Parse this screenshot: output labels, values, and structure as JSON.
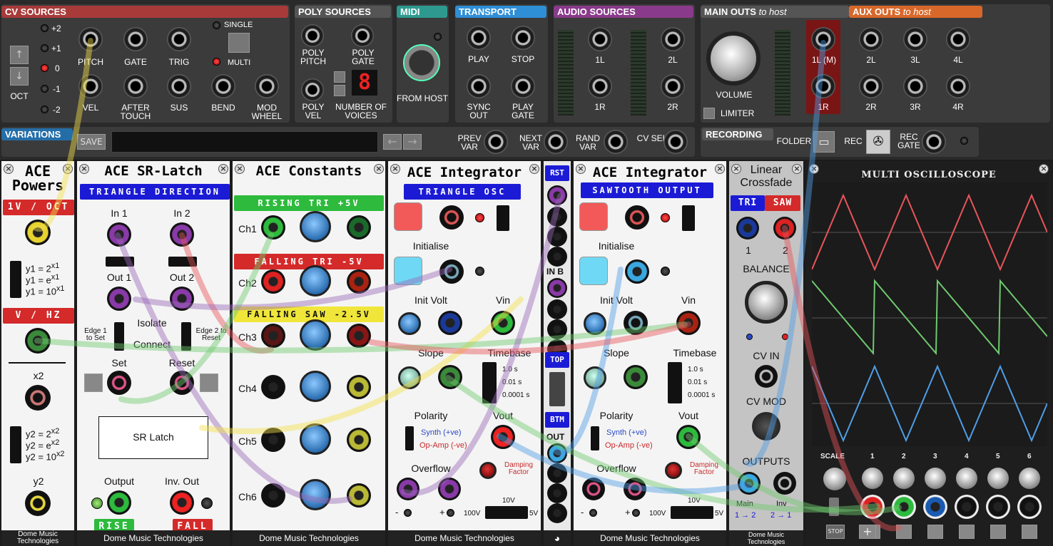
{
  "top": {
    "cv": {
      "title": "CV SOURCES",
      "oct": "OCT",
      "octs": [
        "+2",
        "+1",
        "0",
        "-1",
        "-2"
      ],
      "pitch": "PITCH",
      "gate": "GATE",
      "trig": "TRIG",
      "single": "SINGLE",
      "multi": "MULTI",
      "vel": "VEL",
      "after": "AFTER TOUCH",
      "sus": "SUS",
      "bend": "BEND",
      "mod": "MOD WHEEL"
    },
    "poly": {
      "title": "POLY SOURCES",
      "pitch": "POLY PITCH",
      "gate": "POLY GATE",
      "vel": "POLY VEL",
      "voices": "NUMBER OF VOICES",
      "voices_value": "8"
    },
    "midi": {
      "title": "MIDI",
      "from": "FROM HOST"
    },
    "transport": {
      "title": "TRANSPORT",
      "play": "PLAY",
      "stop": "STOP",
      "sync": "SYNC OUT",
      "playgate": "PLAY GATE"
    },
    "audio": {
      "title": "AUDIO SOURCES",
      "l1": "1L",
      "l2": "2L",
      "r1": "1R",
      "r2": "2R"
    },
    "main": {
      "title": "MAIN OUTS",
      "to": "to host",
      "volume": "VOLUME",
      "limiter": "LIMITER",
      "l1": "1L (M)",
      "r1": "1R"
    },
    "aux": {
      "title": "AUX OUTS",
      "to": "to host",
      "l": [
        "2L",
        "3L",
        "4L"
      ],
      "r": [
        "2R",
        "3R",
        "4R"
      ]
    },
    "variations": {
      "title": "VARIATIONS",
      "save": "SAVE",
      "prev": "PREV VAR",
      "next": "NEXT VAR",
      "rand": "RAND VAR",
      "cvsel": "CV SEL"
    },
    "recording": {
      "title": "RECORDING",
      "folder": "FOLDER",
      "rec": "REC",
      "recgate": "REC GATE"
    }
  },
  "footer": "Dome Music Technologies",
  "powers": {
    "title": "ACE Powers",
    "b1": "1V / OCT",
    "b2": "V / HZ",
    "x2": "x2",
    "y2": "y2",
    "f1": [
      "y1 = 2",
      "y1 = e",
      "y1 = 10"
    ],
    "e1": "x1",
    "f2": [
      "y2 = 2",
      "y2 = e",
      "y2 = 10"
    ],
    "e2": "x2"
  },
  "srlatch": {
    "title": "ACE SR-Latch",
    "banner": "TRIANGLE DIRECTION",
    "in1": "In 1",
    "in2": "In 2",
    "out1": "Out 1",
    "out2": "Out 2",
    "isolate": "Isolate",
    "connect": "Connect",
    "edge1": "Edge 1 to Set",
    "edge2": "Edge 2 to Reset",
    "set": "Set",
    "reset": "Reset",
    "latch": "SR Latch",
    "output": "Output",
    "invout": "Inv. Out",
    "rise": "RISE",
    "fall": "FALL"
  },
  "constants": {
    "title": "ACE Constants",
    "b1": "RISING TRI +5V",
    "b2": "FALLING TRI -5V",
    "b3": "FALLING SAW -2.5V",
    "ch": [
      "Ch1",
      "Ch2",
      "Ch3",
      "Ch4",
      "Ch5",
      "Ch6"
    ]
  },
  "integ1": {
    "title": "ACE Integrator",
    "banner": "TRIANGLE OSC",
    "init": "Initialise",
    "initvolt": "Init Volt",
    "vin": "Vin",
    "slope": "Slope",
    "timebase": "Timebase",
    "tb": [
      "1.0 s",
      "0.01 s",
      "0.0001 s"
    ],
    "polarity": "Polarity",
    "synth": "Synth (+ve)",
    "opamp": "Op-Amp (-ve)",
    "vout": "Vout",
    "overflow": "Overflow",
    "damping": "Damping Factor",
    "minus": "-",
    "plus": "+",
    "v10": "10V",
    "v100": "100V",
    "v5": "5V"
  },
  "sw": {
    "rst": "RST",
    "inb": "IN B",
    "top": "TOP",
    "btm": "BTM",
    "out": "OUT"
  },
  "integ2": {
    "title": "ACE Integrator",
    "banner": "SAWTOOTH OUTPUT",
    "init": "Initialise",
    "initvolt": "Init Volt",
    "vin": "Vin",
    "slope": "Slope",
    "timebase": "Timebase",
    "tb": [
      "1.0 s",
      "0.01 s",
      "0.0001 s"
    ],
    "polarity": "Polarity",
    "synth": "Synth (+ve)",
    "opamp": "Op-Amp (-ve)",
    "vout": "Vout",
    "overflow": "Overflow",
    "damping": "Damping Factor",
    "minus": "-",
    "plus": "+",
    "v10": "10V",
    "v100": "100V",
    "v5": "5V"
  },
  "xfade": {
    "title": "Linear Crossfade",
    "tri": "TRI",
    "saw": "SAW",
    "one": "1",
    "two": "2",
    "balance": "BALANCE",
    "cvin": "CV IN",
    "cvmod": "CV MOD",
    "outputs": "OUTPUTS",
    "main": "Main",
    "inv": "Inv",
    "mainr": "1 → 2",
    "invr": "2 → 1"
  },
  "scope": {
    "title": "MULTI OSCILLOSCOPE",
    "scale": "SCALE",
    "chans": [
      "1",
      "2",
      "3",
      "4",
      "5",
      "6"
    ],
    "stop": "STOP",
    "plus": "+"
  },
  "colors": {
    "red": "#e8555a",
    "green": "#6fc96f",
    "blue": "#4f9ee6",
    "yellow": "#f4e14a",
    "purple": "#9a6ab8",
    "bannerRed": "#d42a2a",
    "bannerBlue": "#1b1bd6",
    "bannerGreen": "#2dba3d"
  }
}
